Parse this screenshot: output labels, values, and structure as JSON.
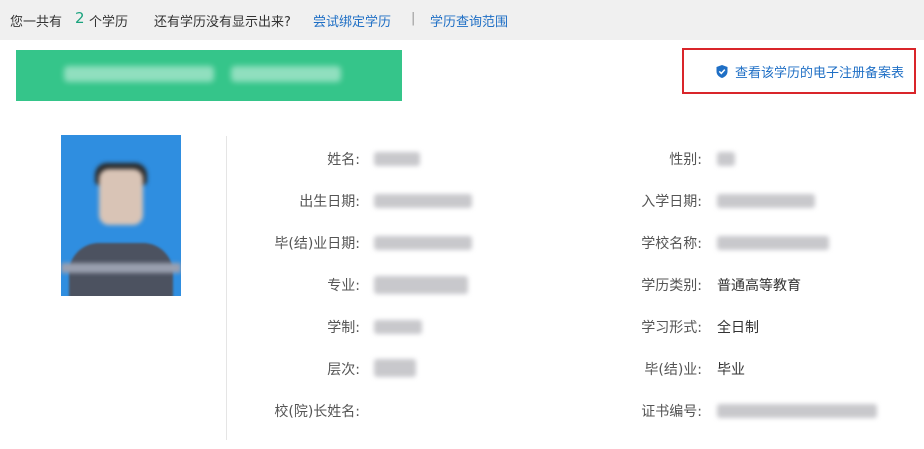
{
  "summary": {
    "prefix": "您一共有",
    "count": "2",
    "suffix": "个学历",
    "missing_question": "还有学历没有显示出来?",
    "bind_link": "尝试绑定学历",
    "divider": "|",
    "scope_link": "学历查询范围"
  },
  "registry_link": {
    "icon": "shield-check-icon",
    "label": "查看该学历的电子注册备案表"
  },
  "fields_left": [
    {
      "label": "姓名:"
    },
    {
      "label": "出生日期:"
    },
    {
      "label": "毕(结)业日期:"
    },
    {
      "label": "专业:"
    },
    {
      "label": "学制:"
    },
    {
      "label": "层次:"
    },
    {
      "label": "校(院)长姓名:"
    }
  ],
  "fields_right": [
    {
      "label": "性别:",
      "value": ""
    },
    {
      "label": "入学日期:",
      "value": ""
    },
    {
      "label": "学校名称:",
      "value": ""
    },
    {
      "label": "学历类别:",
      "value": "普通高等教育"
    },
    {
      "label": "学习形式:",
      "value": "全日制"
    },
    {
      "label": "毕(结)业:",
      "value": "毕业"
    },
    {
      "label": "证书编号:",
      "value": ""
    }
  ],
  "colors": {
    "accent_green": "#35c58a",
    "link_blue": "#1f6fc5",
    "highlight_red": "#d9252a"
  }
}
